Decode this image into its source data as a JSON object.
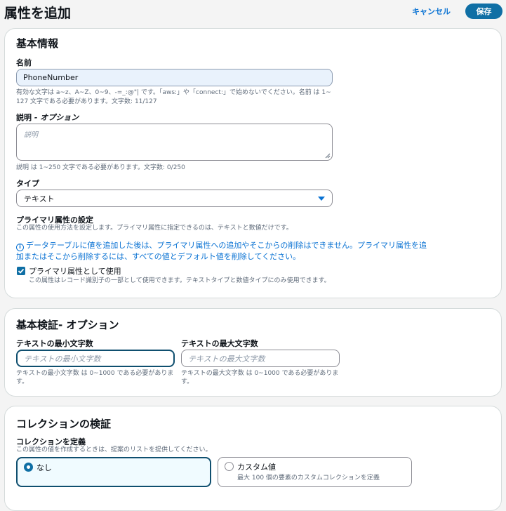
{
  "header": {
    "title": "属性を追加",
    "cancel_label": "キャンセル",
    "save_label": "保存"
  },
  "basic_info": {
    "section_title": "基本情報",
    "name_label": "名前",
    "name_value": "PhoneNumber",
    "name_hint_1": "有効な文字は a~z、A~Z、0~9、-=_:@\"| です。「aws:」や「connect:」で始めないでください。名前 は 1~",
    "name_hint_2": "127 文字である必要があります。文字数: 11/127",
    "desc_label": "説明",
    "desc_optional": " - オプション",
    "desc_placeholder": "説明",
    "desc_hint": "説明 は 1~250 文字である必要があります。文字数: 0/250",
    "type_label": "タイプ",
    "type_value": "テキスト",
    "primary_label": "プライマリ属性の設定",
    "primary_desc": "この属性の使用方法を設定します。プライマリ属性に指定できるのは、テキストと数値だけです。",
    "info_line_1": "データテーブルに値を追加した後は、プライマリ属性への追加やそこからの削除はできません。プライマリ属性を追",
    "info_line_2": "加またはそこから削除するには、すべての値とデフォルト値を削除してください。",
    "checkbox_label": "プライマリ属性として使用",
    "checkbox_desc": "この属性はレコード識別子の一部として使用できます。テキストタイプと数値タイプにのみ使用できます。",
    "checkbox_checked": true
  },
  "validation": {
    "section_title": "基本検証- オプション",
    "min_label": "テキストの最小文字数",
    "min_placeholder": "テキストの最小文字数",
    "min_hint_1": "テキストの最小文字数 は 0~1000 である必要がありま",
    "min_hint_2": "す。",
    "max_label": "テキストの最大文字数",
    "max_placeholder": "テキストの最大文字数",
    "max_hint_1": "テキストの最大文字数 は 0~1000 である必要がありま",
    "max_hint_2": "す。"
  },
  "collection": {
    "section_title": "コレクションの検証",
    "define_label": "コレクションを定義",
    "define_desc": "この属性の値を作成するときは、提案のリストを提供してください。",
    "options": [
      {
        "label": "なし",
        "desc": "",
        "selected": true
      },
      {
        "label": "カスタム値",
        "desc": "最大 100 個の要素のカスタムコレクションを定義",
        "selected": false
      }
    ]
  },
  "colors": {
    "accent": "#0972d3",
    "primary_button": "#0f6fa5"
  }
}
